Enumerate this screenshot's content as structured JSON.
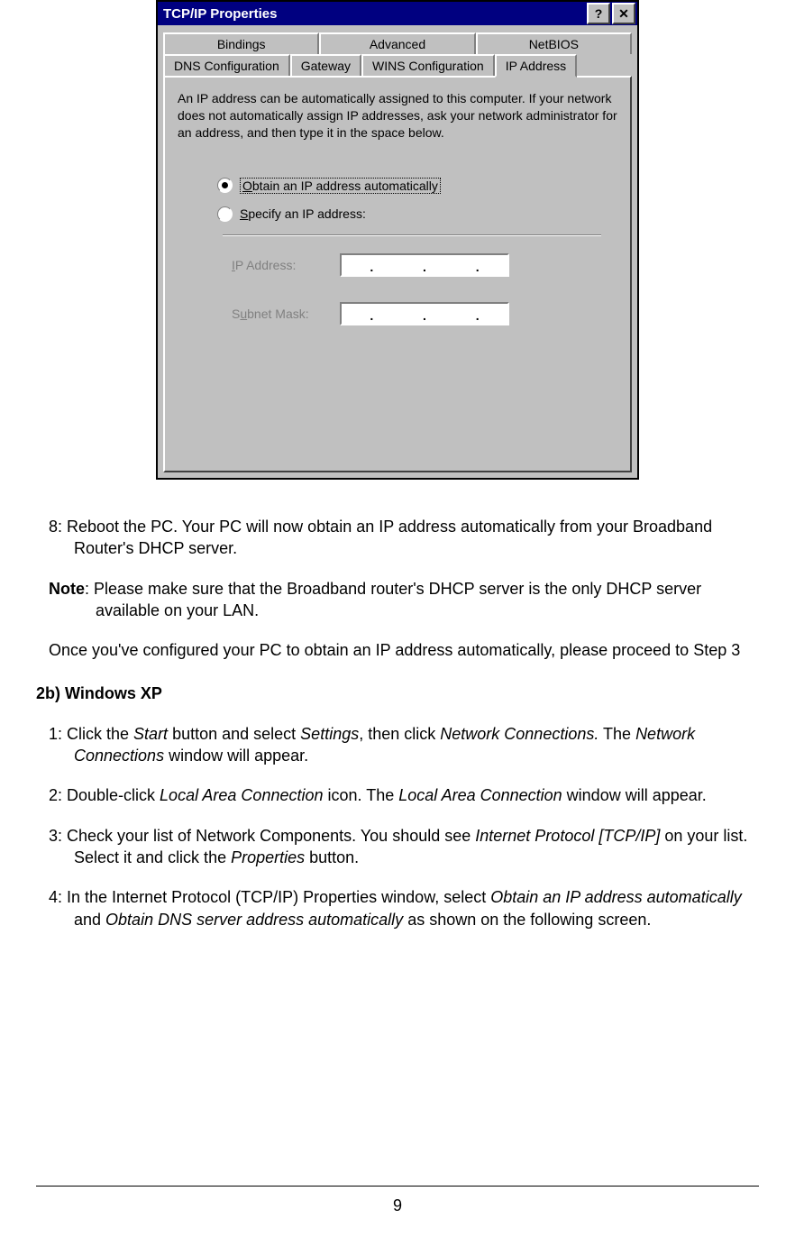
{
  "dialog": {
    "title": "TCP/IP Properties",
    "help_btn": "?",
    "close_btn": "✕",
    "tabs_row1": [
      "Bindings",
      "Advanced",
      "NetBIOS"
    ],
    "tabs_row2": [
      "DNS Configuration",
      "Gateway",
      "WINS Configuration",
      "IP Address"
    ],
    "active_tab": "IP Address",
    "description": "An IP address can be automatically assigned to this computer. If your network does not automatically assign IP addresses, ask your network administrator for an address, and then type it in the space below.",
    "radio_auto": "Obtain an IP address automatically",
    "radio_specify": "Specify an IP address:",
    "selected_radio": "auto",
    "field_ip_label": "IP Address:",
    "field_mask_label": "Subnet Mask:"
  },
  "doc": {
    "step8_prefix": "8: ",
    "step8": "Reboot the PC. Your PC will now obtain an IP address automatically from your Broadband Router's DHCP server.",
    "note_label": "Note",
    "note_text": ": Please make sure that the Broadband router's DHCP server is the only DHCP server available on your LAN.",
    "para_after_note": "Once you've configured your PC to obtain an IP address automatically, please proceed to Step 3",
    "heading_2b": "2b) Windows XP",
    "xp_step1_pre": "1: Click the ",
    "xp_step1_i1": "Start",
    "xp_step1_mid1": " button and select ",
    "xp_step1_i2": "Settings",
    "xp_step1_mid2": ", then click ",
    "xp_step1_i3": "Network Connections.",
    "xp_step1_mid3": " The ",
    "xp_step1_i4": "Network Connections",
    "xp_step1_end": "  window will appear.",
    "xp_step2_pre": "2: Double-click ",
    "xp_step2_i1": "Local Area Connection",
    "xp_step2_mid1": " icon. The ",
    "xp_step2_i2": "Local Area  Connection",
    "xp_step2_end": " window will appear.",
    "xp_step3_pre": "3: Check your list of Network Components. You should see ",
    "xp_step3_i1": "Internet Protocol [TCP/IP]",
    "xp_step3_mid1": " on your list. Select it and click the ",
    "xp_step3_i2": "Properties",
    "xp_step3_end": " button.",
    "xp_step4_pre": "4: In the Internet Protocol (TCP/IP) Properties window, select ",
    "xp_step4_i1": "Obtain an IP address automatically",
    "xp_step4_mid1": " and ",
    "xp_step4_i2": "Obtain DNS server address automatically",
    "xp_step4_end": " as shown on the following screen.",
    "page_number": "9"
  }
}
